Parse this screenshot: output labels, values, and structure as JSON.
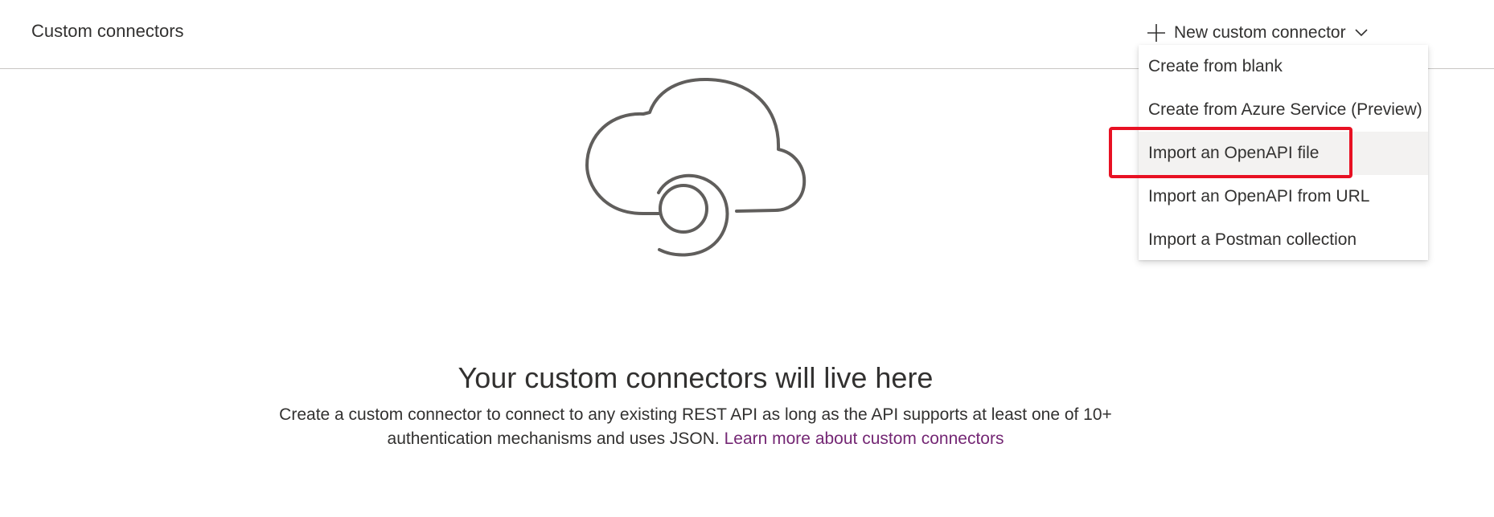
{
  "header": {
    "title": "Custom connectors",
    "new_button_label": "New custom connector",
    "new_button_icon": "plus-icon",
    "dropdown_icon": "chevron-down-icon"
  },
  "dropdown": {
    "items": [
      {
        "label": "Create from blank"
      },
      {
        "label": "Create from Azure Service (Preview)"
      },
      {
        "label": "Import an OpenAPI file"
      },
      {
        "label": "Import an OpenAPI from URL"
      },
      {
        "label": "Import a Postman collection"
      }
    ],
    "hovered_index": 2,
    "highlight_color": "#e81123"
  },
  "empty_state": {
    "illustration": "cloud-connector-icon",
    "title": "Your custom connectors will live here",
    "description": "Create a custom connector to connect to any existing REST API as long as the API supports at least one of 10+ authentication mechanisms and uses JSON.",
    "link_text": "Learn more about custom connectors"
  },
  "colors": {
    "link": "#742774",
    "divider": "#c8c6c4",
    "hover_bg": "#f3f2f1"
  }
}
